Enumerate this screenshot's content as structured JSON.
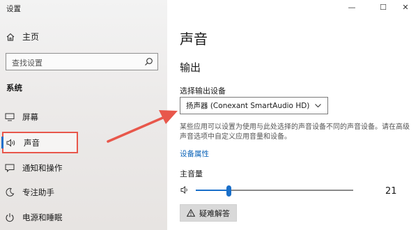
{
  "app": {
    "title": "设置"
  },
  "window_controls": {
    "minimize": "—",
    "maximize": "☐",
    "close": "✕"
  },
  "sidebar": {
    "home_label": "主页",
    "search_placeholder": "查找设置",
    "section_label": "系统",
    "items": [
      {
        "label": "屏幕",
        "icon": "monitor-icon"
      },
      {
        "label": "声音",
        "icon": "speaker-icon",
        "active": true
      },
      {
        "label": "通知和操作",
        "icon": "notification-icon"
      },
      {
        "label": "专注助手",
        "icon": "moon-icon"
      },
      {
        "label": "电源和睡眠",
        "icon": "power-icon"
      }
    ]
  },
  "main": {
    "title": "声音",
    "section_title": "输出",
    "device_label": "选择输出设备",
    "device_value": "扬声器 (Conexant SmartAudio HD)",
    "description": "某些应用可以设置为使用与此处选择的声音设备不同的声音设备。请在高级声音选项中自定义应用音量和设备。",
    "device_properties_link": "设备属性",
    "volume_label": "主音量",
    "volume_value": "21",
    "volume_fraction": 0.21,
    "troubleshoot_label": "疑难解答"
  },
  "colors": {
    "accent": "#1a6fc9",
    "highlight_border": "#e8574b",
    "arrow": "#e8574b"
  }
}
